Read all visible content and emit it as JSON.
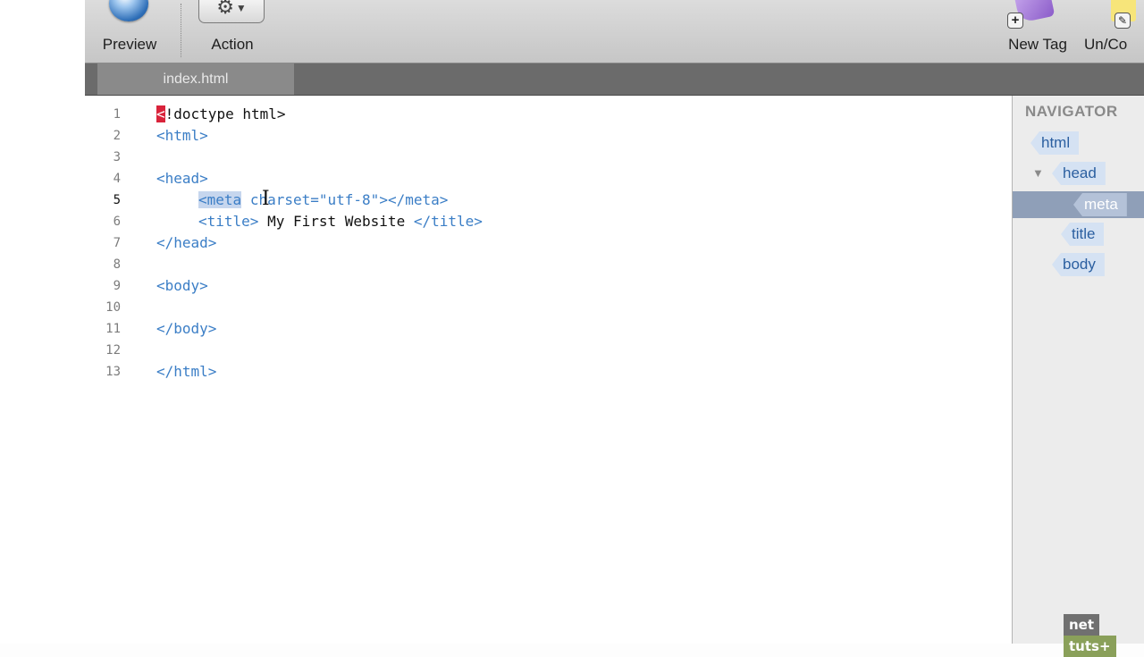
{
  "toolbar": {
    "preview_label": "Preview",
    "action_label": "Action",
    "new_tag_label": "New Tag",
    "uncomment_label": "Un/Co"
  },
  "tabs": [
    {
      "label": "index.html"
    }
  ],
  "editor": {
    "active_line": 5,
    "line_numbers": [
      "1",
      "2",
      "3",
      "4",
      "5",
      "6",
      "7",
      "8",
      "9",
      "10",
      "11",
      "12",
      "13"
    ],
    "code": {
      "l1_lt": "<",
      "l1_rest": "!doctype html>",
      "l2": "<html>",
      "l4": "<head>",
      "l5_meta": "<meta",
      "l5_attr": "charset=",
      "l5_val": "\"utf-8\"",
      "l5_close": "></meta>",
      "l6_open": "<title>",
      "l6_text": " My First Website ",
      "l6_close": "</title>",
      "l7": "</head>",
      "l9": "<body>",
      "l11": "</body>",
      "l13": "</html>"
    }
  },
  "navigator": {
    "title": "NAVIGATOR",
    "nodes": [
      "html",
      "head",
      "meta",
      "title",
      "body"
    ],
    "selected": "meta"
  },
  "watermark": {
    "part1": "net",
    "part2": "tuts+"
  }
}
